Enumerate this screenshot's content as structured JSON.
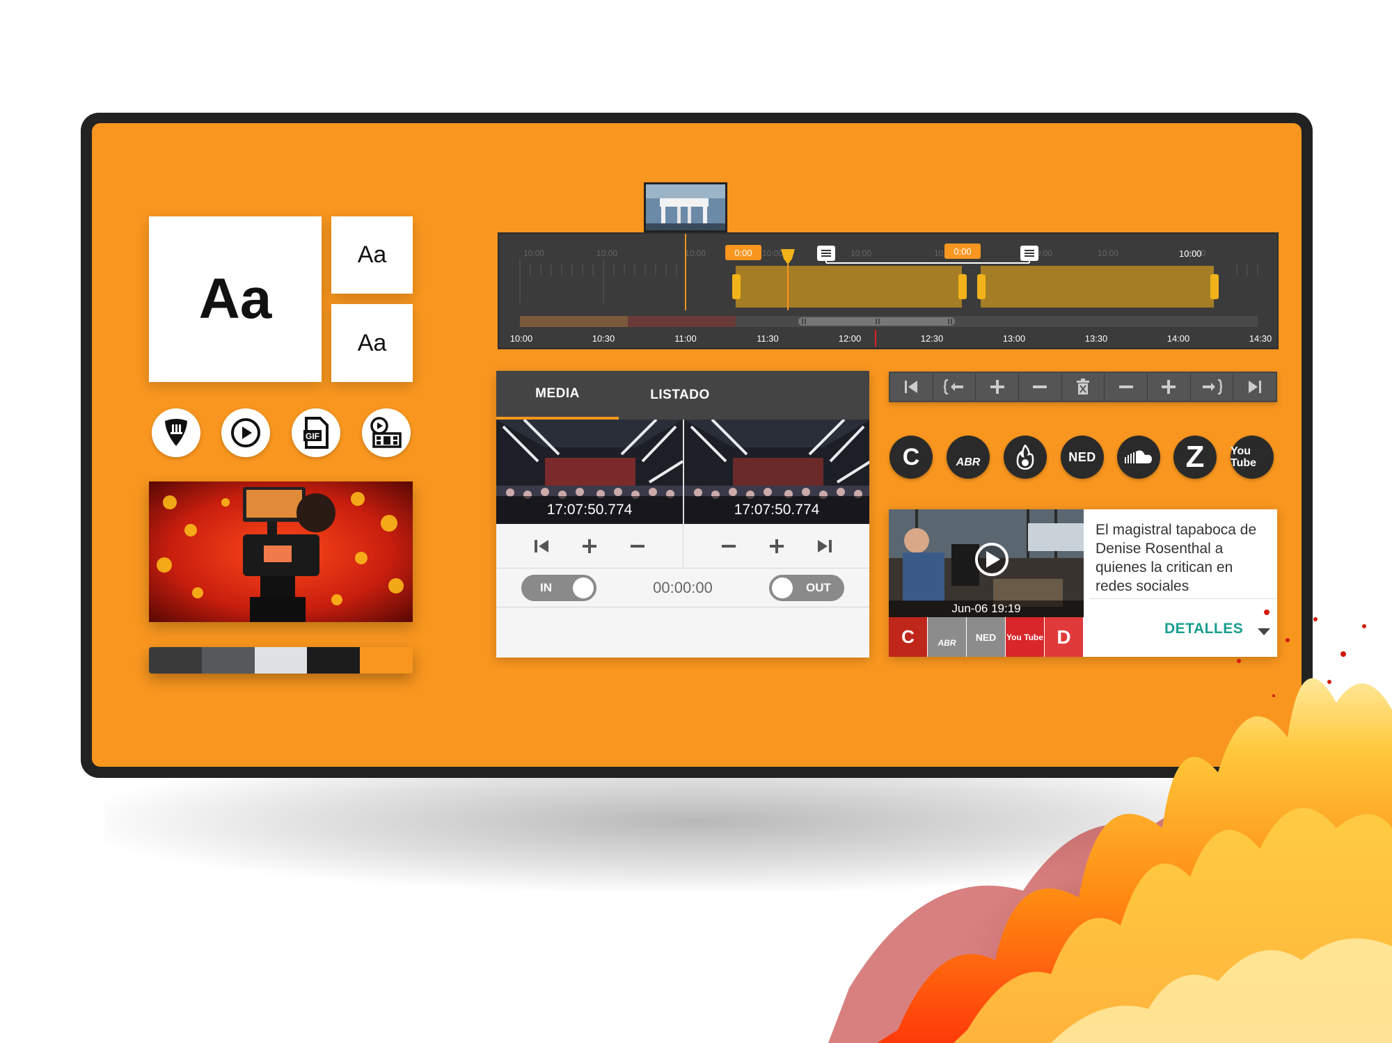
{
  "typography": {
    "big_sample": "Aa",
    "small_sample_1": "Aa",
    "small_sample_2": "Aa"
  },
  "feature_icons": [
    "pick-icon",
    "play-circle-icon",
    "gif-file-icon",
    "video-file-icon"
  ],
  "palette": [
    "#3a3a3a",
    "#56595c",
    "#dfe2e4",
    "#1c1c1c",
    "#f8961f"
  ],
  "timeline": {
    "ticks": [
      "10:00",
      "10:30",
      "11:00",
      "11:30",
      "12:00",
      "12:30",
      "13:00",
      "13:30",
      "14:00",
      "14:30"
    ],
    "clip_badge_1": "0:00",
    "clip_badge_2": "0:00",
    "faded_labels": [
      "10:00",
      "10:00",
      "10:00",
      "10:00",
      "10:00",
      "10:00",
      "10:00",
      "10:00",
      "10:00"
    ],
    "end_label": "10:00"
  },
  "media_panel": {
    "tabs": [
      "MEDIA",
      "LISTADO"
    ],
    "frame_in_time": "17:07:50.774",
    "frame_out_time": "17:07:50.774",
    "in_label": "IN",
    "out_label": "OUT",
    "duration": "00:00:00"
  },
  "toolbar": {
    "tools": [
      "skip-start-icon",
      "mark-in-icon",
      "plus-icon",
      "minus-icon",
      "delete-icon",
      "minus-icon",
      "plus-icon",
      "mark-out-icon",
      "skip-end-icon"
    ]
  },
  "brands": [
    "C",
    "ABR",
    "flame",
    "NED",
    "soundcloud",
    "Z",
    "You Tube"
  ],
  "news": {
    "title": "El magistral tapaboca de Denise Rosenthal a quienes la critican en redes sociales",
    "date": "Jun-06 19:19",
    "details_label": "DETALLES",
    "sources": [
      "C",
      "ABR",
      "NED",
      "You Tube",
      "D"
    ]
  },
  "colors": {
    "accent": "#f8961f",
    "frame": "#222222",
    "teal": "#1a9e8f",
    "timeline_bg": "#3b3b3b"
  }
}
